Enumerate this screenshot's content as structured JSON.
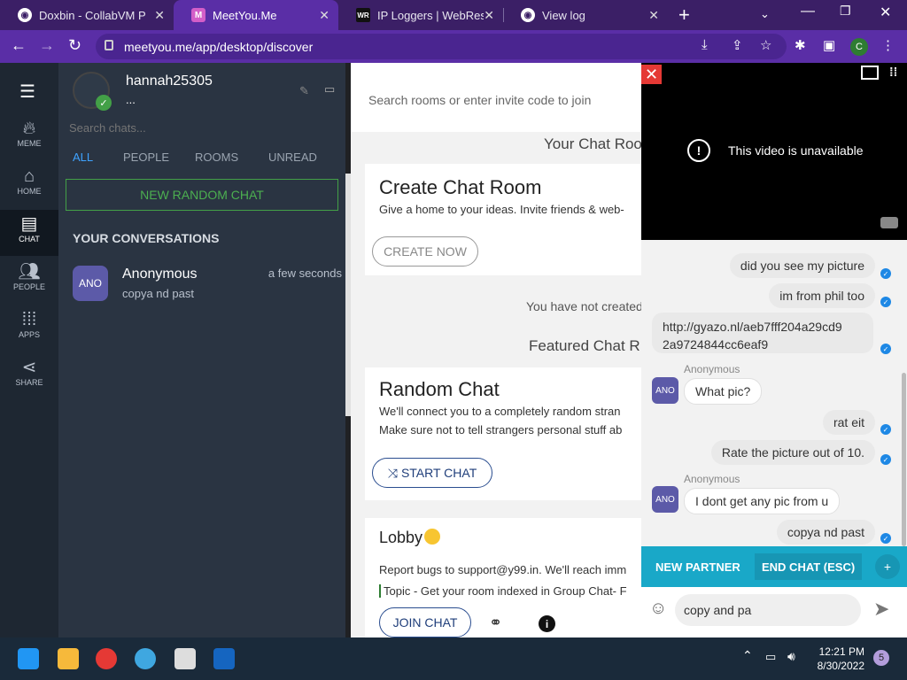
{
  "browser": {
    "tabs": [
      {
        "title": "Doxbin - CollabVM Puz",
        "active": false
      },
      {
        "title": "MeetYou.Me",
        "active": true
      },
      {
        "title": "IP Loggers | WebResol",
        "active": false
      },
      {
        "title": "View log",
        "active": false
      }
    ],
    "url": "meetyou.me/app/desktop/discover",
    "profile_initial": "C"
  },
  "rail": [
    {
      "label": "MEME",
      "icon": "fire-icon"
    },
    {
      "label": "HOME",
      "icon": "home-icon"
    },
    {
      "label": "CHAT",
      "icon": "chat-icon",
      "active": true
    },
    {
      "label": "PEOPLE",
      "icon": "people-icon"
    },
    {
      "label": "APPS",
      "icon": "apps-icon"
    },
    {
      "label": "SHARE",
      "icon": "share-icon"
    }
  ],
  "conversations": {
    "username": "hannah25305",
    "status": "...",
    "search_placeholder": "Search chats...",
    "filters": [
      "ALL",
      "PEOPLE",
      "ROOMS",
      "UNREAD"
    ],
    "new_random_chat": "NEW RANDOM CHAT",
    "heading": "YOUR CONVERSATIONS",
    "items": [
      {
        "avatar": "ANO",
        "name": "Anonymous",
        "preview": "copya nd past",
        "time": "a few seconds"
      }
    ]
  },
  "discover": {
    "search_placeholder": "Search rooms or enter invite code to join",
    "your_rooms": "Your Chat Roo",
    "create_title": "Create Chat Room",
    "create_desc": "Give a home to your ideas. Invite friends & web-",
    "create_btn": "CREATE NOW",
    "none_created": "You have not created",
    "featured": "Featured Chat R",
    "random_title": "Random Chat",
    "random_desc1": "We'll connect you to a completely random stran",
    "random_desc2": "Make sure not to tell strangers personal stuff ab",
    "start_btn": "START CHAT",
    "lobby_title": "Lobby",
    "lobby_desc": "Report bugs to support@y99.in. We'll reach imm",
    "lobby_topic": "Topic - Get your room indexed in Group Chat- F",
    "join_btn": "JOIN CHAT"
  },
  "chat": {
    "video_msg": "This video is unavailable",
    "messages": [
      {
        "text": "did you see my picture",
        "dir": "out"
      },
      {
        "text": "im from phil too",
        "dir": "out"
      },
      {
        "text": "http://gyazo.nl/aeb7fff204a29cd9",
        "text2": "2a9724844cc6eaf9",
        "dir": "out"
      },
      {
        "sender": "Anonymous",
        "avatar": "ANO",
        "text": "What pic?",
        "dir": "in"
      },
      {
        "text": "rat eit",
        "dir": "out"
      },
      {
        "text": "Rate the picture out of 10.",
        "dir": "out"
      },
      {
        "sender": "Anonymous",
        "avatar": "ANO",
        "text": "I dont get any pic from u",
        "dir": "in"
      },
      {
        "text": "copya nd past",
        "dir": "out"
      }
    ],
    "new_partner": "NEW PARTNER",
    "end_chat": "END CHAT (ESC)",
    "input_value": "copy and pa"
  },
  "taskbar": {
    "time": "12:21 PM",
    "date": "8/30/2022",
    "notifications": "5"
  }
}
